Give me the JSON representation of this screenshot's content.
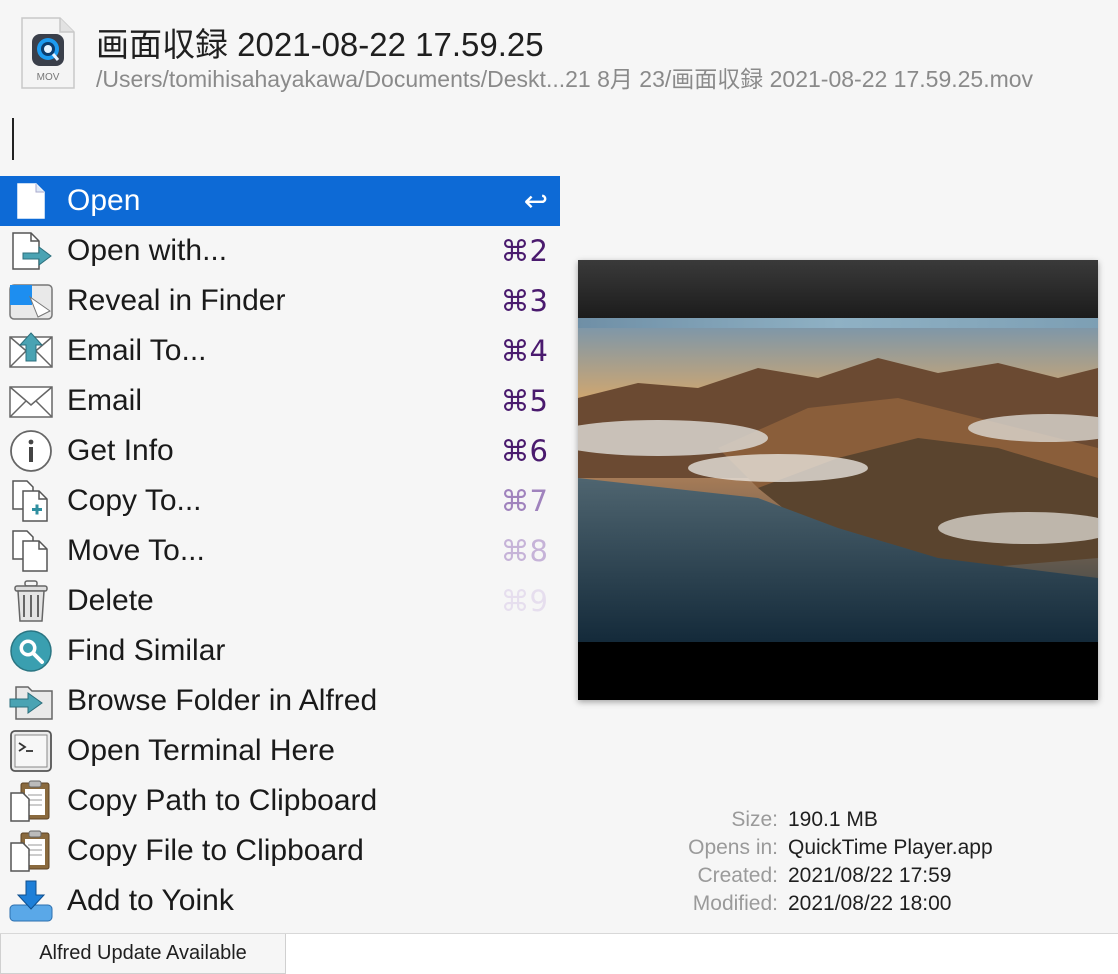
{
  "header": {
    "title": "画面収録 2021-08-22 17.59.25",
    "path": "/Users/tomihisahayakawa/Documents/Deskt...21 8月 23/画面収録 2021-08-22 17.59.25.mov",
    "file_icon_label": "MOV"
  },
  "search": {
    "value": ""
  },
  "actions": [
    {
      "label": "Open",
      "shortcut": "↩",
      "shortcut_color": "#ffffff",
      "icon": "document-icon",
      "selected": true
    },
    {
      "label": "Open with...",
      "shortcut": "⌘2",
      "shortcut_color": "#4a1a6e",
      "icon": "open-with-icon"
    },
    {
      "label": "Reveal in Finder",
      "shortcut": "⌘3",
      "shortcut_color": "#4a1a6e",
      "icon": "finder-icon"
    },
    {
      "label": "Email To...",
      "shortcut": "⌘4",
      "shortcut_color": "#4a1a6e",
      "icon": "email-to-icon"
    },
    {
      "label": "Email",
      "shortcut": "⌘5",
      "shortcut_color": "#4a1a6e",
      "icon": "envelope-icon"
    },
    {
      "label": "Get Info",
      "shortcut": "⌘6",
      "shortcut_color": "#4a1a6e",
      "icon": "info-icon"
    },
    {
      "label": "Copy To...",
      "shortcut": "⌘7",
      "shortcut_color": "#a083bd",
      "icon": "copy-to-icon"
    },
    {
      "label": "Move To...",
      "shortcut": "⌘8",
      "shortcut_color": "#c6b3d8",
      "icon": "move-to-icon"
    },
    {
      "label": "Delete",
      "shortcut": "⌘9",
      "shortcut_color": "#e6deee",
      "icon": "trash-icon"
    },
    {
      "label": "Find Similar",
      "shortcut": "",
      "icon": "magnifier-icon"
    },
    {
      "label": "Browse Folder in Alfred",
      "shortcut": "",
      "icon": "browse-folder-icon"
    },
    {
      "label": "Open Terminal Here",
      "shortcut": "",
      "icon": "terminal-icon"
    },
    {
      "label": "Copy Path to Clipboard",
      "shortcut": "",
      "icon": "clipboard-icon"
    },
    {
      "label": "Copy File to Clipboard",
      "shortcut": "",
      "icon": "clipboard-icon"
    },
    {
      "label": "Add to Yoink",
      "shortcut": "",
      "icon": "yoink-download-icon"
    }
  ],
  "info": [
    {
      "key": "Size:",
      "value": "190.1 MB"
    },
    {
      "key": "Opens in:",
      "value": "QuickTime Player.app"
    },
    {
      "key": "Created:",
      "value": "2021/08/22 17:59"
    },
    {
      "key": "Modified:",
      "value": "2021/08/22 18:00"
    }
  ],
  "update_notice": "Alfred Update Available",
  "colors": {
    "selection": "#0d6ad6",
    "accent_teal": "#3a9fb0"
  }
}
